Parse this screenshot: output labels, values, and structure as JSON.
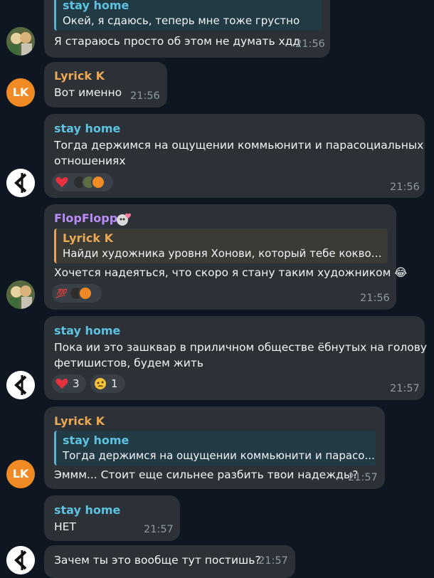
{
  "colors": {
    "background": "#0e1621",
    "bubble": "#2b3137",
    "stay_home": "#5ec1e0",
    "lyrick": "#eba955",
    "flop": "#b98df5",
    "time": "#8e9aa3"
  },
  "messages": {
    "m1": {
      "reply_author": "stay home",
      "reply_text": "Окей, я сдаюсь, теперь мне тоже грустно",
      "text": "Я стараюсь просто об этом не думать хдд",
      "time": "21:56"
    },
    "m2": {
      "author": "Lyrick K",
      "text": "Вот именно",
      "time": "21:56",
      "avatar_initials": "LK"
    },
    "m3": {
      "author": "stay home",
      "text_line1": "Тогда держимся на ощущении коммьюнити и парасоциальных",
      "text_line2": "отношениях",
      "time": "21:56",
      "reaction_icon": "heart-icon"
    },
    "m4": {
      "author": "FlopFlopps",
      "reply_author": "Lyrick K",
      "reply_text": "Найди художника уровня Хонови, который тебе коквор...",
      "text": "Хочется надеяться, что скоро я стану таким художником 😂",
      "time": "21:56",
      "reaction_icon": "hundred-icon"
    },
    "m5": {
      "author": "stay home",
      "text_line1": "Пока ии это зашквар в приличном обществе ёбнутых на голову",
      "text_line2": "фетишистов, будем жить",
      "time": "21:57",
      "reactions": [
        {
          "icon": "heart-icon",
          "count": "3"
        },
        {
          "icon": "pleading-face-icon",
          "count": "1"
        }
      ]
    },
    "m6": {
      "author": "Lyrick K",
      "reply_author": "stay home",
      "reply_text": "Тогда держимся на ощущении коммьюнити и парасо...",
      "text": "Эммм... Стоит еще сильнее разбить твои надежды?",
      "time": "21:57",
      "avatar_initials": "LK"
    },
    "m7": {
      "author": "stay home",
      "text": "НЕТ",
      "time": "21:57"
    },
    "m8": {
      "text": "Зачем ты это вообще тут постишь?",
      "time": "21:57"
    }
  }
}
